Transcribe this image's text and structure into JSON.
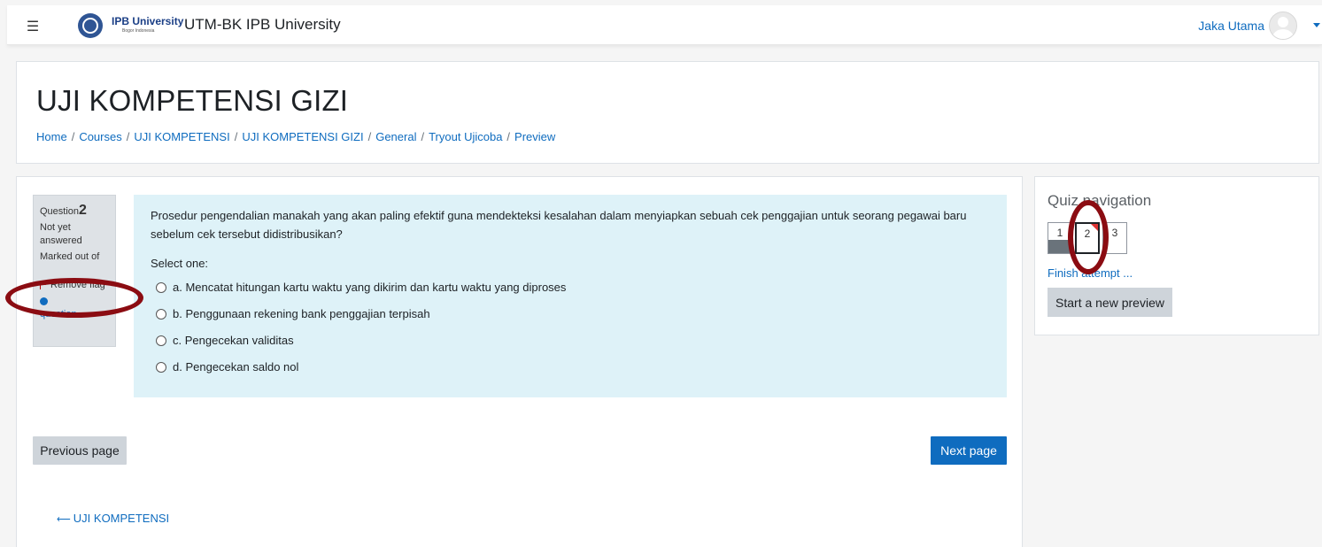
{
  "header": {
    "menu_icon": "hamburger-icon",
    "brand_logo_text": "IPB University",
    "brand_logo_subtext": "Bogor Indonesia",
    "site_name": "UTM-BK IPB University",
    "user_name": "Jaka Utama"
  },
  "page": {
    "title": "UJI KOMPETENSI GIZI",
    "breadcrumb": [
      "Home",
      "Courses",
      "UJI KOMPETENSI",
      "UJI KOMPETENSI GIZI",
      "General",
      "Tryout Ujicoba",
      "Preview"
    ]
  },
  "question_info": {
    "label": "Question",
    "number": "2",
    "status": "Not yet answered",
    "marked_out_of": "Marked out of",
    "flag_label": "Remove flag",
    "edit_question_label": "question"
  },
  "question": {
    "text": "Prosedur pengendalian manakah yang akan paling efektif guna mendekteksi kesalahan dalam menyiapkan sebuah cek penggajian untuk seorang pegawai baru sebelum cek tersebut didistribusikan?",
    "prompt": "Select one:",
    "options": [
      "a. Mencatat hitungan kartu waktu yang dikirim dan kartu waktu yang diproses",
      "b. Penggunaan rekening bank penggajian terpisah",
      "c. Pengecekan validitas",
      "d. Pengecekan saldo nol"
    ]
  },
  "buttons": {
    "previous": "Previous page",
    "next": "Next page",
    "back_link": "UJI KOMPETENSI"
  },
  "quiz_nav": {
    "title": "Quiz navigation",
    "questions": [
      "1",
      "2",
      "3"
    ],
    "finish_attempt": "Finish attempt ...",
    "start_new_preview": "Start a new preview"
  },
  "colors": {
    "accent": "#0f6cbf",
    "question_background": "#def2f8",
    "annotation": "#8b0c12"
  }
}
